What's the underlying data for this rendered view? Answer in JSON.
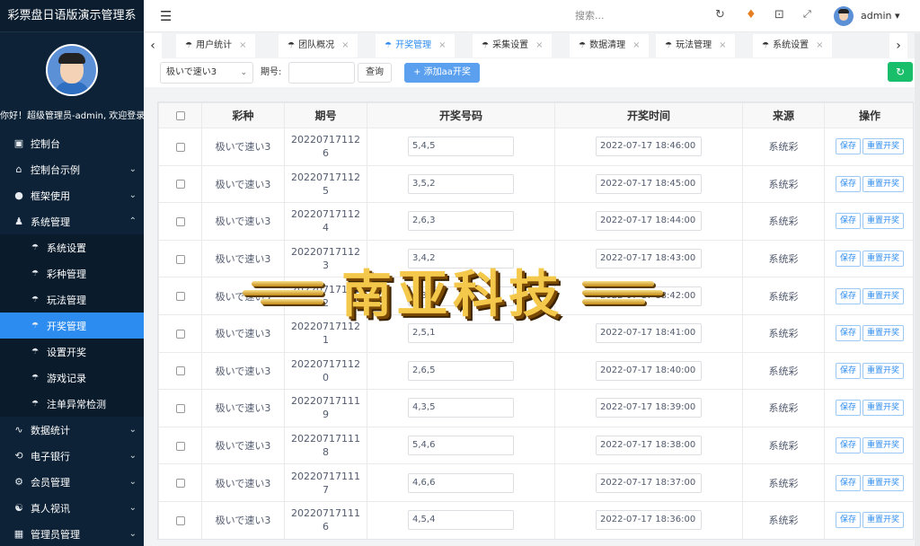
{
  "sidebar": {
    "brand": "彩票盘日语版演示管理系",
    "welcome": "你好！超级管理员-admin, 欢迎登录",
    "menu": [
      {
        "icon": "dashboard-icon",
        "glyph": "▣",
        "label": "控制台",
        "chevron": ""
      },
      {
        "icon": "home-icon",
        "glyph": "⌂",
        "label": "控制台示例",
        "chevron": "⌄"
      },
      {
        "icon": "framework-icon",
        "glyph": "●",
        "label": "框架使用",
        "chevron": "⌄"
      },
      {
        "icon": "user-icon",
        "glyph": "♟",
        "label": "系统管理",
        "chevron": "⌃"
      }
    ],
    "submenu": [
      {
        "label": "系统设置"
      },
      {
        "label": "彩种管理"
      },
      {
        "label": "玩法管理"
      },
      {
        "label": "开奖管理",
        "active": true
      },
      {
        "label": "设置开奖"
      },
      {
        "label": "游戏记录"
      },
      {
        "label": "注单异常检测"
      }
    ],
    "menu2": [
      {
        "icon": "chart-icon",
        "glyph": "∿",
        "label": "数据统计",
        "chevron": "⌄"
      },
      {
        "icon": "bank-icon",
        "glyph": "⟲",
        "label": "电子银行",
        "chevron": "⌄"
      },
      {
        "icon": "gear-icon",
        "glyph": "⚙",
        "label": "会员管理",
        "chevron": "⌄"
      },
      {
        "icon": "video-icon",
        "glyph": "☯",
        "label": "真人视讯",
        "chevron": "⌄"
      },
      {
        "icon": "admin-icon",
        "glyph": "▦",
        "label": "管理员管理",
        "chevron": "⌄"
      }
    ]
  },
  "topbar": {
    "search_placeholder": "搜索...",
    "username": "admin ▾"
  },
  "tabs": [
    {
      "label": "用户统计",
      "active": false
    },
    {
      "label": "团队概况",
      "active": false
    },
    {
      "label": "开奖管理",
      "active": true
    },
    {
      "label": "采集设置",
      "active": false
    },
    {
      "label": "数据清理",
      "active": false
    },
    {
      "label": "玩法管理",
      "active": false
    },
    {
      "label": "系统设置",
      "active": false
    }
  ],
  "filters": {
    "select_value": "极いで速い3",
    "period_label": "期号:",
    "query_label": "查询",
    "add_label": "+ 添加aa开奖"
  },
  "table": {
    "headers": [
      "彩种",
      "期号",
      "开奖号码",
      "开奖时间",
      "来源",
      "操作"
    ],
    "save_label": "保存",
    "reset_label": "重置开奖",
    "rows": [
      {
        "lottery": "极いで速い3",
        "period": "202207171126",
        "numbers": "5,4,5",
        "time": "2022-07-17 18:46:00",
        "source": "系统彩"
      },
      {
        "lottery": "极いで速い3",
        "period": "202207171125",
        "numbers": "3,5,2",
        "time": "2022-07-17 18:45:00",
        "source": "系统彩"
      },
      {
        "lottery": "极いで速い3",
        "period": "202207171124",
        "numbers": "2,6,3",
        "time": "2022-07-17 18:44:00",
        "source": "系统彩"
      },
      {
        "lottery": "极いで速い3",
        "period": "202207171123",
        "numbers": "3,4,2",
        "time": "2022-07-17 18:43:00",
        "source": "系统彩"
      },
      {
        "lottery": "极いで速い3",
        "period": "202207171122",
        "numbers": "1,3,6",
        "time": "2022-07-17 18:42:00",
        "source": "系统彩"
      },
      {
        "lottery": "极いで速い3",
        "period": "202207171121",
        "numbers": "2,5,1",
        "time": "2022-07-17 18:41:00",
        "source": "系统彩"
      },
      {
        "lottery": "极いで速い3",
        "period": "202207171120",
        "numbers": "2,6,5",
        "time": "2022-07-17 18:40:00",
        "source": "系统彩"
      },
      {
        "lottery": "极いで速い3",
        "period": "202207171119",
        "numbers": "4,3,5",
        "time": "2022-07-17 18:39:00",
        "source": "系统彩"
      },
      {
        "lottery": "极いで速い3",
        "period": "202207171118",
        "numbers": "5,4,6",
        "time": "2022-07-17 18:38:00",
        "source": "系统彩"
      },
      {
        "lottery": "极いで速い3",
        "period": "202207171117",
        "numbers": "4,6,6",
        "time": "2022-07-17 18:37:00",
        "source": "系统彩"
      },
      {
        "lottery": "极いで速い3",
        "period": "202207171116",
        "numbers": "4,5,4",
        "time": "2022-07-17 18:36:00",
        "source": "系统彩"
      }
    ]
  },
  "watermark": {
    "text": "南亚科技"
  }
}
